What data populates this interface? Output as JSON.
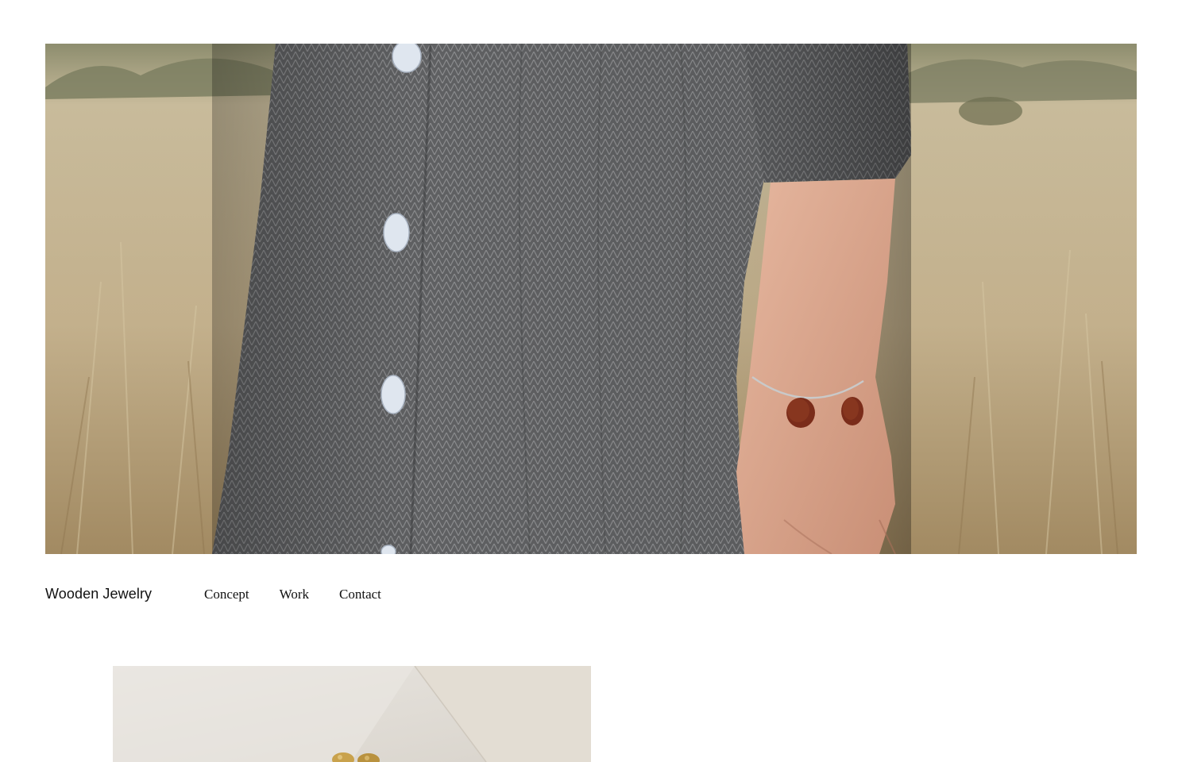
{
  "site": {
    "brand": "Wooden Jewelry"
  },
  "nav": {
    "items": [
      {
        "label": "Concept"
      },
      {
        "label": "Work"
      },
      {
        "label": "Contact"
      }
    ]
  },
  "hero": {
    "image_name": "hero-photo"
  },
  "gallery": {
    "image_name": "product-photo"
  },
  "colors": {
    "background": "#ffffff",
    "text": "#111111",
    "dress": "#5e5f60",
    "field": "#b9ab8c",
    "wood": "#7a2c1a"
  }
}
